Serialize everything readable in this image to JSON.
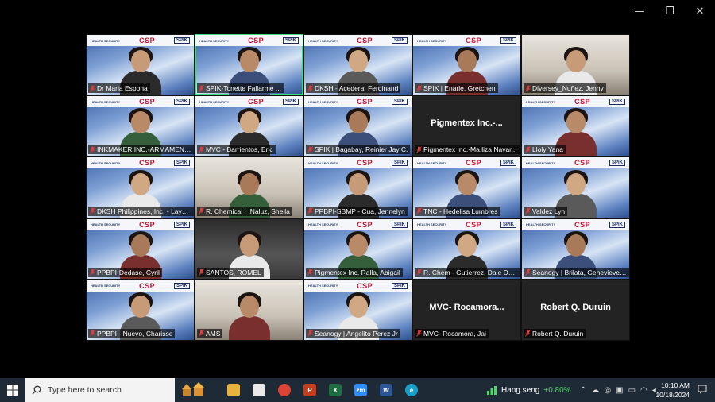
{
  "window": {
    "minimize": "—",
    "restore": "❐",
    "close": "✕"
  },
  "banner": {
    "left_text": "HEALTH SECURITY",
    "csp": "CSP",
    "spik": "SPIK"
  },
  "tiles": [
    {
      "name": "Dr Maria Espona",
      "kind": "video",
      "banner": true
    },
    {
      "name": "SPIK-Tonette Fallarme ...",
      "kind": "video",
      "banner": true,
      "active": true
    },
    {
      "name": "DKSH - Acedera, Ferdinand",
      "kind": "video",
      "banner": true
    },
    {
      "name": "SPIK | Enarle, Gretchen",
      "kind": "video",
      "banner": true
    },
    {
      "name": "Diversey_Nuñez, Jenny",
      "kind": "office",
      "banner": false
    },
    {
      "name": "INKMAKER INC.-ARMAMENT...",
      "kind": "video",
      "banner": true
    },
    {
      "name": "MVC - Barrientos, Eric",
      "kind": "video",
      "banner": true
    },
    {
      "name": "SPIK | Bagabay, Reinier Jay C.",
      "kind": "video",
      "banner": true
    },
    {
      "name": "Pigmentex Inc.-Ma.liza Navar...",
      "kind": "name-only",
      "center": "Pigmentex  Inc.-..."
    },
    {
      "name": "Lloly Yana",
      "kind": "video",
      "banner": true
    },
    {
      "name": "DKSH Philippines, Inc. - Layog...",
      "kind": "video",
      "banner": true
    },
    {
      "name": "R. Chemical _ Naluz, Sheila",
      "kind": "office",
      "banner": false
    },
    {
      "name": "PPBPI-SBMP - Cua, Jennelyn",
      "kind": "video",
      "banner": true
    },
    {
      "name": "TNC - Hedelisa Lumbres",
      "kind": "video",
      "banner": true
    },
    {
      "name": "Valdez Lyn",
      "kind": "video",
      "banner": true
    },
    {
      "name": "PPBPI-Dedase, Cyril",
      "kind": "video",
      "banner": true
    },
    {
      "name": "SANTOS, ROMEL",
      "kind": "dark-room",
      "banner": false
    },
    {
      "name": "Pigmentex Inc. Ralla, Abigail",
      "kind": "video",
      "banner": true
    },
    {
      "name": "R. Chem - Gutierrez, Dale Daryl S.",
      "kind": "video",
      "banner": true
    },
    {
      "name": "Seanogy | Brilata, Genevieve ...",
      "kind": "video",
      "banner": true
    },
    {
      "name": "PPBPI - Nuevo, Charisse",
      "kind": "video",
      "banner": true
    },
    {
      "name": "AMS",
      "kind": "office",
      "banner": false
    },
    {
      "name": "Seanogy | Angelito Perez Jr",
      "kind": "video",
      "banner": true
    },
    {
      "name": "MVC- Rocamora, Jai",
      "kind": "name-only",
      "center": "MVC-  Rocamora..."
    },
    {
      "name": "Robert Q. Duruin",
      "kind": "name-only",
      "center": "Robert Q. Duruin"
    }
  ],
  "taskbar": {
    "search_placeholder": "Type here to search",
    "ticker_label": "Hang seng",
    "ticker_change": "+0.80%",
    "time": "10:10 AM",
    "date": "10/18/2024",
    "apps": [
      {
        "name": "file-explorer",
        "glyph": "",
        "color": "#e8b33a"
      },
      {
        "name": "notepad",
        "glyph": "",
        "color": "#e9e9e9"
      },
      {
        "name": "chrome",
        "glyph": "",
        "color": "#db4437"
      },
      {
        "name": "powerpoint",
        "glyph": "P",
        "color": "#c43e1c"
      },
      {
        "name": "excel",
        "glyph": "X",
        "color": "#1d6f42"
      },
      {
        "name": "zoom",
        "glyph": "zm",
        "color": "#2d8cff"
      },
      {
        "name": "word",
        "glyph": "W",
        "color": "#2b579a"
      },
      {
        "name": "edge",
        "glyph": "e",
        "color": "#1aa1c9"
      }
    ]
  },
  "colors": {
    "active_border": "#3ddc84",
    "muted_mic": "#e03c3c",
    "taskbar": "#1f2a37"
  }
}
